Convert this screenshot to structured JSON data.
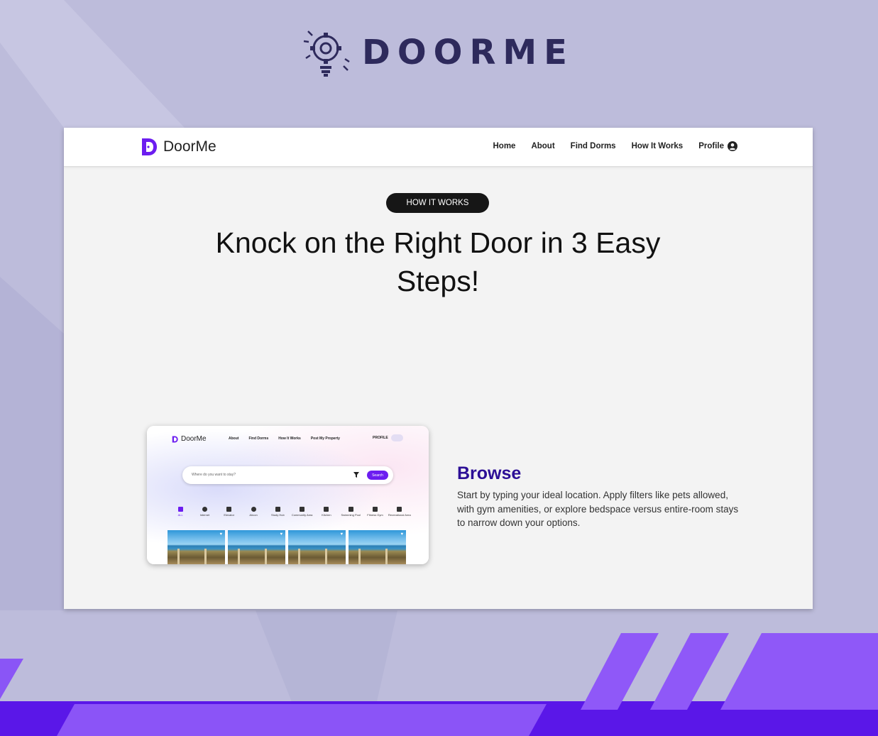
{
  "brand": {
    "name": "DOORME",
    "icon": "lightbulb-gear-icon"
  },
  "nav": {
    "logo_text": "DoorMe",
    "links": [
      "Home",
      "About",
      "Find Dorms",
      "How It Works"
    ],
    "profile_label": "Profile"
  },
  "hero": {
    "pill": "HOW IT WORKS",
    "headline": "Knock on the Right Door in 3 Easy Steps!"
  },
  "mockup": {
    "logo_text": "DoorMe",
    "nav": [
      "About",
      "Find Dorms",
      "How It Works",
      "Post My Property"
    ],
    "profile_label": "PROFILE",
    "search_placeholder": "Where do you want to stay?",
    "search_button": "Search",
    "categories": [
      "ALL",
      "Internet",
      "Elevator",
      "Aircon",
      "Study Hub",
      "Community Area",
      "Kitchen",
      "Swimming Pool",
      "Fitness Gym",
      "Recreational Area"
    ]
  },
  "step": {
    "title": "Browse",
    "description": "Start by typing your ideal location. Apply filters like pets allowed, with gym amenities, or explore bedspace versus entire-room stays to narrow down your options."
  },
  "colors": {
    "accent": "#6c1df0",
    "brand_dark": "#2e2a5c",
    "background": "#bdbcdb"
  }
}
